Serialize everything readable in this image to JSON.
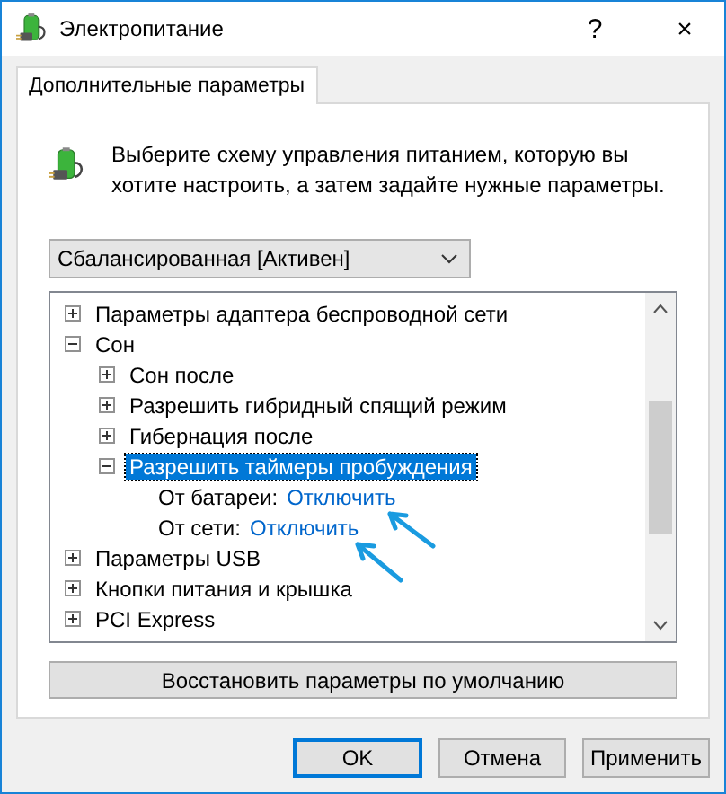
{
  "window": {
    "title": "Электропитание",
    "help": "?",
    "close": "×"
  },
  "tabs": [
    {
      "label": "Дополнительные параметры",
      "selected": true
    }
  ],
  "description": "Выберите схему управления питанием, которую вы хотите настроить, а затем задайте нужные параметры.",
  "plan_select": {
    "value": "Сбалансированная [Активен]"
  },
  "tree": [
    {
      "label": "Параметры адаптера беспроводной сети",
      "expanded": false,
      "selected": false
    },
    {
      "label": "Сон",
      "expanded": true,
      "selected": false,
      "children": [
        {
          "label": "Сон после",
          "expanded": false,
          "selected": false
        },
        {
          "label": "Разрешить гибридный спящий режим",
          "expanded": false,
          "selected": false
        },
        {
          "label": "Гибернация после",
          "expanded": false,
          "selected": false
        },
        {
          "label": "Разрешить таймеры пробуждения",
          "expanded": true,
          "selected": true,
          "settings": [
            {
              "label": "От батареи:",
              "value": "Отключить"
            },
            {
              "label": "От сети:",
              "value": "Отключить"
            }
          ]
        }
      ]
    },
    {
      "label": "Параметры USB",
      "expanded": false,
      "selected": false
    },
    {
      "label": "Кнопки питания и крышка",
      "expanded": false,
      "selected": false
    },
    {
      "label": "PCI Express",
      "expanded": false,
      "selected": false
    }
  ],
  "restore_button": "Восстановить параметры по умолчанию",
  "buttons": [
    {
      "label": "OK",
      "selected": true
    },
    {
      "label": "Отмена",
      "selected": false
    },
    {
      "label": "Применить",
      "selected": false
    }
  ]
}
